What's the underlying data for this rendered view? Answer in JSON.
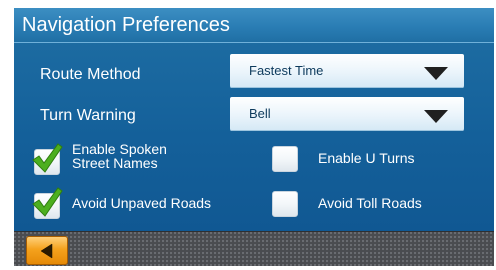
{
  "header": {
    "title": "Navigation Preferences"
  },
  "settings": {
    "route_method": {
      "label": "Route Method",
      "value": "Fastest Time"
    },
    "turn_warning": {
      "label": "Turn Warning",
      "value": "Bell"
    }
  },
  "options": {
    "spoken_street_names": {
      "label_line1": "Enable Spoken",
      "label_line2": "Street Names",
      "checked": true
    },
    "u_turns": {
      "label": "Enable U Turns",
      "checked": false
    },
    "unpaved_roads": {
      "label": "Avoid Unpaved Roads",
      "checked": true
    },
    "toll_roads": {
      "label": "Avoid Toll Roads",
      "checked": false
    }
  },
  "footer": {
    "back_icon": "back-arrow-icon"
  },
  "colors": {
    "background": "#14609a",
    "check_green": "#4caf1f",
    "back_button": "#f5a21d"
  }
}
